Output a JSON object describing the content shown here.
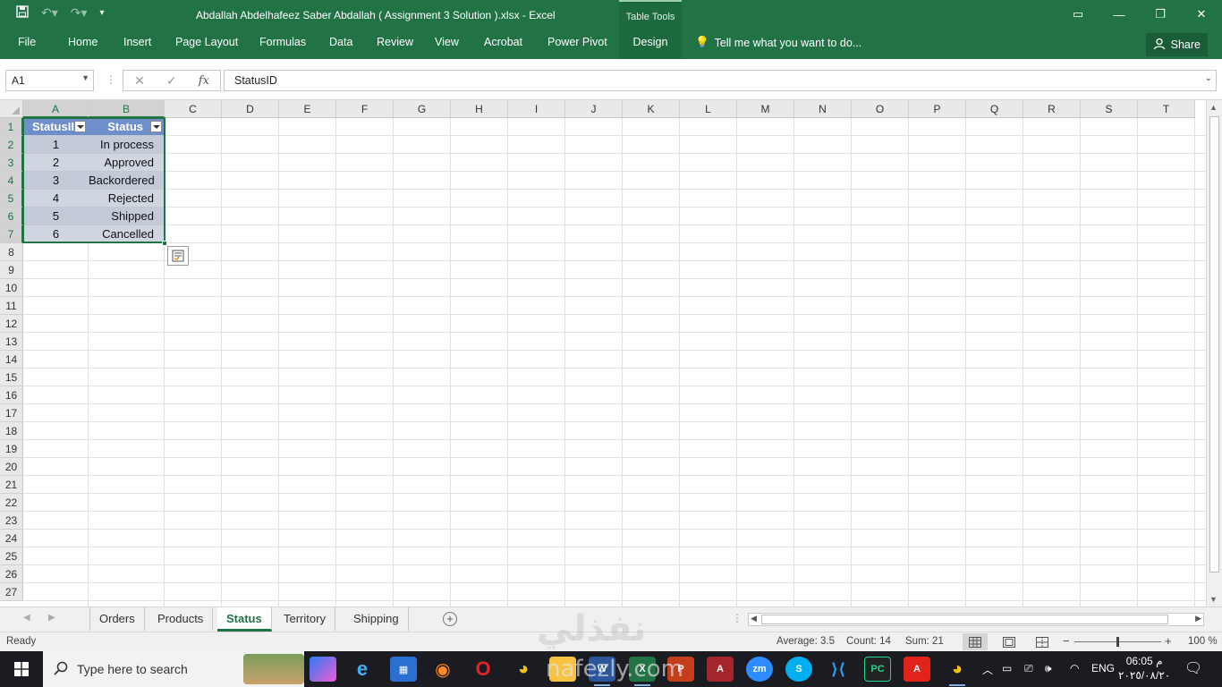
{
  "title_bar": {
    "doc_title": "Abdallah Abdelhafeez Saber Abdallah ( Assignment 3 Solution ).xlsx - Excel",
    "context_group": "Table Tools"
  },
  "ribbon": {
    "tabs": [
      "File",
      "Home",
      "Insert",
      "Page Layout",
      "Formulas",
      "Data",
      "Review",
      "View",
      "Acrobat",
      "Power Pivot",
      "Design"
    ],
    "tell_me": "Tell me what you want to do...",
    "share": "Share"
  },
  "formula_bar": {
    "name_box": "A1",
    "fx": "fx",
    "content": "StatusID"
  },
  "grid": {
    "columns": [
      "A",
      "B",
      "C",
      "D",
      "E",
      "F",
      "G",
      "H",
      "I",
      "J",
      "K",
      "L",
      "M",
      "N",
      "O",
      "P",
      "Q",
      "R",
      "S",
      "T"
    ],
    "rows": [
      "1",
      "2",
      "3",
      "4",
      "5",
      "6",
      "7",
      "8",
      "9",
      "10",
      "11",
      "12",
      "13",
      "14",
      "15",
      "16",
      "17",
      "18",
      "19",
      "20",
      "21",
      "22",
      "23",
      "24",
      "25",
      "26",
      "27"
    ]
  },
  "table": {
    "headers": [
      "StatusII",
      "Status"
    ],
    "rows": [
      [
        "1",
        "In process"
      ],
      [
        "2",
        "Approved"
      ],
      [
        "3",
        "Backordered"
      ],
      [
        "4",
        "Rejected"
      ],
      [
        "5",
        "Shipped"
      ],
      [
        "6",
        "Cancelled"
      ]
    ],
    "colors": {
      "header": "#4472c4",
      "band_odd": "#b4c6e7",
      "band_even": "#d9e1f2"
    }
  },
  "sheet_tabs": [
    "Orders",
    "Products",
    "Status",
    "Territory",
    "Shipping"
  ],
  "active_sheet": "Status",
  "status_bar": {
    "mode": "Ready",
    "average": "Average: 3.5",
    "count": "Count: 14",
    "sum": "Sum: 21",
    "zoom": "100 %"
  },
  "taskbar": {
    "search_placeholder": "Type here to search",
    "language": "ENG",
    "time": "06:05 م",
    "date": "٢٠٢٥/٠٨/٢٠"
  },
  "watermark": {
    "arabic": "نفذلي",
    "latin": "nafezly.com"
  },
  "accent_color": "#217346"
}
